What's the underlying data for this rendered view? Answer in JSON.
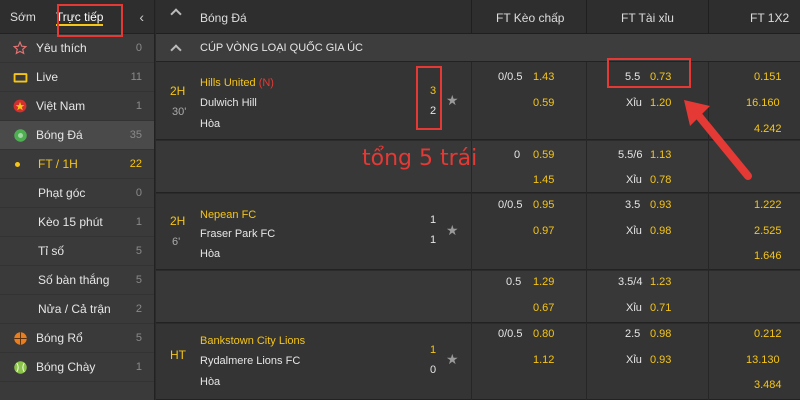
{
  "sidebar": {
    "tabs": [
      {
        "label": "Sớm"
      },
      {
        "label": "Trực tiếp"
      }
    ],
    "items": [
      {
        "label": "Yêu thích",
        "count": "0",
        "icon": "star-outline-icon"
      },
      {
        "label": "Live",
        "count": "11",
        "icon": "tv-icon"
      },
      {
        "label": "Việt Nam",
        "count": "1",
        "icon": "vietnam-flag-icon"
      },
      {
        "label": "Bóng Đá",
        "count": "35",
        "icon": "soccer-ball-icon"
      },
      {
        "label": "FT / 1H",
        "count": "22"
      },
      {
        "label": "Phạt góc",
        "count": "0"
      },
      {
        "label": "Kèo 15 phút",
        "count": "1"
      },
      {
        "label": "Tỉ số",
        "count": "5"
      },
      {
        "label": "Số bàn thắng",
        "count": "5"
      },
      {
        "label": "Nửa / Cả trận",
        "count": "2"
      },
      {
        "label": "Bóng Rổ",
        "count": "5",
        "icon": "basketball-icon"
      },
      {
        "label": "Bóng Chày",
        "count": "1",
        "icon": "baseball-icon"
      }
    ]
  },
  "header": {
    "sport": "Bóng Đá",
    "col_handicap": "FT Kèo chấp",
    "col_ou": "FT Tài xỉu",
    "col_1x2": "FT 1X2"
  },
  "league": "CÚP VÒNG LOẠI QUỐC GIA ÚC",
  "annotation": "tổng 5 trái",
  "matches": [
    {
      "status": "2H",
      "minute": "30'",
      "home": "Hills United",
      "neutral": "(N)",
      "away": "Dulwich Hill",
      "draw": "Hòa",
      "home_score": "3",
      "away_score": "2",
      "hdp_line": "0/0.5",
      "hdp_home": "1.43",
      "hdp_away": "0.59",
      "ou_line": "5.5",
      "ou_over": "0.73",
      "ou_under_label": "Xỉu",
      "ou_under": "1.20",
      "x_home": "0.151",
      "x_away": "16.160",
      "x_draw": "4.242"
    },
    {
      "hdp_line": "0",
      "hdp_home": "0.59",
      "hdp_away": "1.45",
      "ou_line": "5.5/6",
      "ou_over": "1.13",
      "ou_under_label": "Xỉu",
      "ou_under": "0.78"
    },
    {
      "status": "2H",
      "minute": "6'",
      "home": "Nepean FC",
      "away": "Fraser Park FC",
      "draw": "Hòa",
      "home_score": "1",
      "away_score": "1",
      "hdp_line": "0/0.5",
      "hdp_home": "0.95",
      "hdp_away": "0.97",
      "ou_line": "3.5",
      "ou_over": "0.93",
      "ou_under_label": "Xỉu",
      "ou_under": "0.98",
      "x_home": "1.222",
      "x_away": "2.525",
      "x_draw": "1.646"
    },
    {
      "hdp_line": "0.5",
      "hdp_home": "1.29",
      "hdp_away": "0.67",
      "ou_line": "3.5/4",
      "ou_over": "1.23",
      "ou_under_label": "Xỉu",
      "ou_under": "0.71"
    },
    {
      "status": "HT",
      "home": "Bankstown City Lions",
      "away": "Rydalmere Lions FC",
      "draw": "Hòa",
      "home_score": "1",
      "away_score": "0",
      "hdp_line": "0/0.5",
      "hdp_home": "0.80",
      "hdp_away": "1.12",
      "ou_line": "2.5",
      "ou_over": "0.98",
      "ou_under_label": "Xỉu",
      "ou_under": "0.93",
      "x_home": "0.212",
      "x_away": "13.130",
      "x_draw": "3.484"
    }
  ],
  "colors": {
    "accent": "#f5c518",
    "highlight": "#e53935"
  }
}
